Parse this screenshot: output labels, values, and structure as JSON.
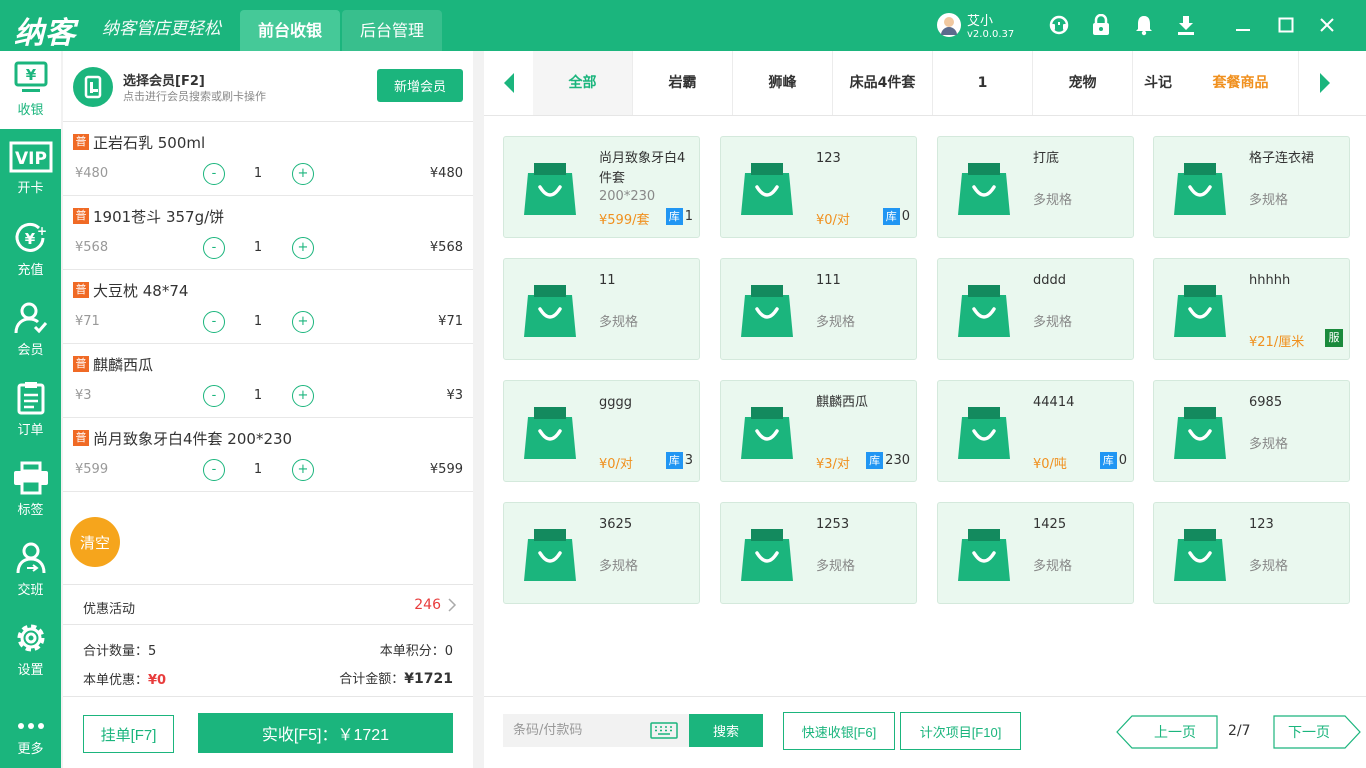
{
  "titlebar": {
    "logo": "纳客",
    "slogan": "纳客管店更轻松",
    "tabs": [
      {
        "label": "前台收银",
        "active": true
      },
      {
        "label": "后台管理",
        "active": false
      }
    ],
    "user_name": "艾小",
    "version": "v2.0.0.37",
    "icons": [
      "headset-icon",
      "lock-icon",
      "bell-icon",
      "download-icon",
      "minimize-icon",
      "maximize-icon",
      "close-icon"
    ]
  },
  "nav": {
    "items": [
      {
        "label": "收银",
        "icon": "cashier-icon",
        "active": true
      },
      {
        "label": "开卡",
        "icon": "vip-card-icon"
      },
      {
        "label": "充值",
        "icon": "recharge-icon"
      },
      {
        "label": "会员",
        "icon": "member-icon"
      },
      {
        "label": "订单",
        "icon": "order-icon"
      },
      {
        "label": "标签",
        "icon": "printer-icon"
      },
      {
        "label": "交班",
        "icon": "shift-icon"
      },
      {
        "label": "设置",
        "icon": "gear-icon"
      },
      {
        "label": "更多",
        "icon": "more-icon"
      }
    ]
  },
  "member": {
    "title": "选择会员[F2]",
    "subtitle": "点击进行会员搜索或刷卡操作",
    "add_label": "新增会员"
  },
  "cart": {
    "badge": "普",
    "items": [
      {
        "name": "正岩石乳 500ml",
        "price": "¥480",
        "qty": "1",
        "total": "¥480"
      },
      {
        "name": "1901苍斗 357g/饼",
        "price": "¥568",
        "qty": "1",
        "total": "¥568"
      },
      {
        "name": "大豆枕 48*74",
        "price": "¥71",
        "qty": "1",
        "total": "¥71"
      },
      {
        "name": "麒麟西瓜",
        "price": "¥3",
        "qty": "1",
        "total": "¥3"
      },
      {
        "name": "尚月致象牙白4件套 200*230",
        "price": "¥599",
        "qty": "1",
        "total": "¥599"
      }
    ],
    "minus": "-",
    "plus": "+",
    "clear_label": "清空",
    "promo_label": "优惠活动",
    "promo_value": "246",
    "total_qty_label": "合计数量：",
    "total_qty": "5",
    "points_label": "本单积分：",
    "points": "0",
    "discount_label": "本单优惠：",
    "discount": "¥0",
    "amount_label": "合计金额：",
    "amount": "¥1721",
    "hold_label": "挂单[F7]",
    "pay_label": "实收[F5]：￥1721"
  },
  "categories": [
    {
      "label": "全部",
      "active": true
    },
    {
      "label": "岩霸"
    },
    {
      "label": "狮峰"
    },
    {
      "label": "床品4件套"
    },
    {
      "label": "1"
    },
    {
      "label": "宠物"
    },
    {
      "label": "斗记"
    },
    {
      "label": "套餐商品",
      "highlight": true
    }
  ],
  "products": [
    {
      "name": "尚月致象牙白4件套",
      "spec": "200*230",
      "price": "¥599/套",
      "stock": "1"
    },
    {
      "name": "123",
      "price": "¥0/对",
      "stock": "0"
    },
    {
      "name": "打底",
      "multi": "多规格"
    },
    {
      "name": "格子连衣裙",
      "multi": "多规格"
    },
    {
      "name": "11",
      "multi": "多规格"
    },
    {
      "name": "111",
      "multi": "多规格"
    },
    {
      "name": "dddd",
      "multi": "多规格"
    },
    {
      "name": "hhhhh",
      "price": "¥21/厘米",
      "service": "服"
    },
    {
      "name": "gggg",
      "price": "¥0/对",
      "stock": "3"
    },
    {
      "name": "麒麟西瓜",
      "price": "¥3/对",
      "stock": "230"
    },
    {
      "name": "44414",
      "price": "¥0/吨",
      "stock": "0"
    },
    {
      "name": "6985",
      "multi": "多规格"
    },
    {
      "name": "3625",
      "multi": "多规格"
    },
    {
      "name": "1253",
      "multi": "多规格"
    },
    {
      "name": "1425",
      "multi": "多规格"
    },
    {
      "name": "123",
      "multi": "多规格"
    }
  ],
  "stock_badge": "库",
  "footer": {
    "barcode_placeholder": "条码/付款码",
    "search_label": "搜索",
    "quick_label": "快速收银[F6]",
    "count_label": "计次项目[F10]",
    "prev_label": "上一页",
    "page": "2/7",
    "next_label": "下一页"
  },
  "colors": {
    "brand": "#1bb57d",
    "orange": "#f0901e",
    "red": "#e83d3d",
    "blue": "#2196f3"
  }
}
